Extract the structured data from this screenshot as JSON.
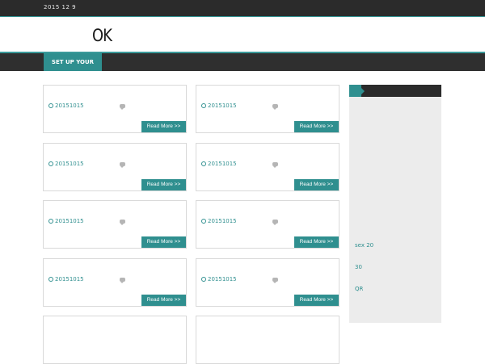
{
  "topbar": {
    "date": "2015  12  9"
  },
  "header": {
    "logo": "OK"
  },
  "nav": {
    "menu_label": "SET UP YOUR MENU"
  },
  "posts": [
    {
      "date": "20151015",
      "read_more": "Read More >>"
    },
    {
      "date": "20151015",
      "read_more": "Read More >>"
    },
    {
      "date": "20151015",
      "read_more": "Read More >>"
    },
    {
      "date": "20151015",
      "read_more": "Read More >>"
    },
    {
      "date": "20151015",
      "read_more": "Read More >>"
    },
    {
      "date": "20151015",
      "read_more": "Read More >>"
    },
    {
      "date": "20151015",
      "read_more": "Read More >>"
    },
    {
      "date": "20151015",
      "read_more": "Read More >>"
    }
  ],
  "sidebar": {
    "links": [
      "sex 20",
      "30",
      "QR"
    ]
  },
  "icons": {
    "date_icon": "clock-icon",
    "comment_icon": "comment-icon",
    "widget_tab": "arrow-tab-icon"
  },
  "colors": {
    "accent": "#2f8f8f",
    "dark": "#2b2b2b",
    "sidebar_bg": "#ececec"
  }
}
